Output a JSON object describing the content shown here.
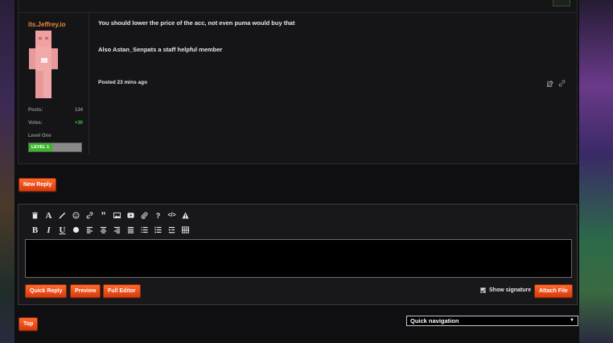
{
  "post": {
    "username": "its.Jeffrey.io",
    "stats": [
      {
        "label": "Posts:",
        "value": "134"
      },
      {
        "label": "Votes:",
        "value": "+30"
      }
    ],
    "rank": "Level One",
    "level_badge": "LEVEL 1",
    "level_progress_percent": 45,
    "message_lines": [
      "You should lower the price of the acc, not even puma would buy that",
      "Also Astan_Senpats a staff helpful member"
    ],
    "posted": "Posted 23 mins ago",
    "action_icons": [
      "edit-icon",
      "link-icon"
    ]
  },
  "buttons": {
    "new_reply": "New Reply",
    "quick_reply": "Quick Reply",
    "preview": "Preview",
    "full_editor": "Full Editor",
    "attach_file": "Attach File",
    "top": "Top"
  },
  "editor": {
    "toolbar_row1": [
      "trash-icon",
      "font-icon",
      "brush-icon",
      "smiley-icon",
      "link-icon",
      "quote-icon",
      "image-icon",
      "video-icon",
      "attachment-icon",
      "help-icon",
      "code-icon",
      "warning-icon"
    ],
    "toolbar_row2": [
      "bold-icon",
      "italic-icon",
      "underline-icon",
      "color-icon",
      "align-left-icon",
      "align-center-icon",
      "align-right-icon",
      "align-justify-icon",
      "bullet-list-icon",
      "numbered-list-icon",
      "indent-icon",
      "table-icon"
    ],
    "show_signature_label": "Show signature",
    "show_signature_checked": true,
    "text_value": ""
  },
  "quick_navigation": {
    "selected": "Quick navigation"
  },
  "colors": {
    "accent": "#e8491a",
    "username": "#f08a3a",
    "votes": "#3ac43a",
    "level": "#3ab82a"
  }
}
